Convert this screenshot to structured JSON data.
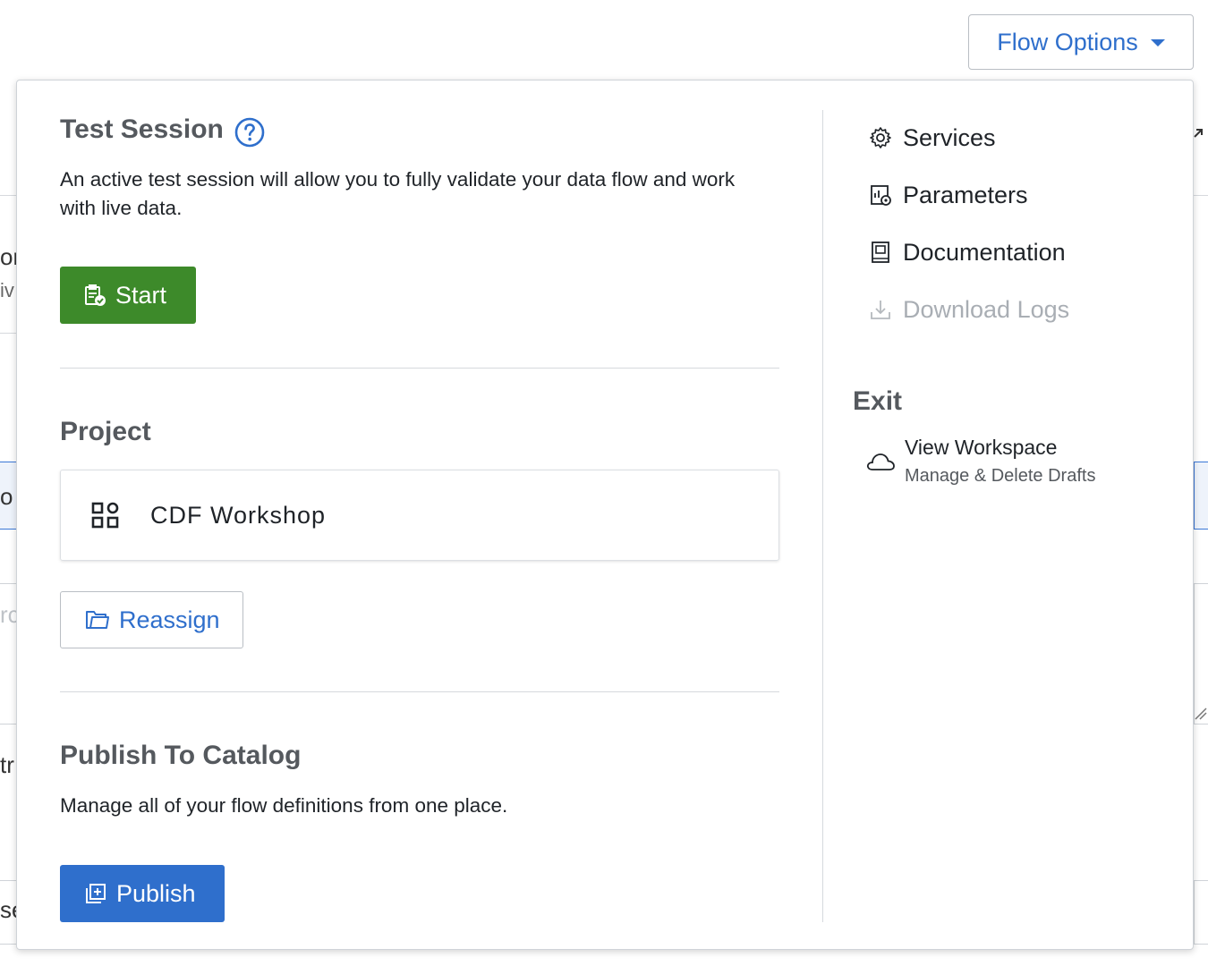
{
  "header": {
    "flow_options_label": "Flow Options"
  },
  "background_fragments": {
    "frag_1": "orl",
    "frag_2": "iv",
    "frag_3": "o",
    "frag_4": "rc",
    "frag_5": "tr",
    "frag_6": "se"
  },
  "test_session": {
    "title": "Test Session",
    "description": "An active test session will allow you to fully validate your data flow and work with live data.",
    "start_label": "Start"
  },
  "project": {
    "title": "Project",
    "name": "CDF Workshop",
    "reassign_label": "Reassign"
  },
  "publish": {
    "title": "Publish To Catalog",
    "description": "Manage all of your flow definitions from one place.",
    "publish_label": "Publish"
  },
  "menu": {
    "items": [
      {
        "label": "Services",
        "icon": "gear-icon",
        "enabled": true
      },
      {
        "label": "Parameters",
        "icon": "parameters-icon",
        "enabled": true
      },
      {
        "label": "Documentation",
        "icon": "book-icon",
        "enabled": true
      },
      {
        "label": "Download Logs",
        "icon": "download-icon",
        "enabled": false
      }
    ]
  },
  "exit": {
    "title": "Exit",
    "workspace_label": "View Workspace",
    "workspace_sublabel": "Manage & Delete Drafts"
  },
  "colors": {
    "accent_blue": "#2f6fcc",
    "start_green": "#3d8a2a",
    "disabled_gray": "#a9aeb4"
  }
}
